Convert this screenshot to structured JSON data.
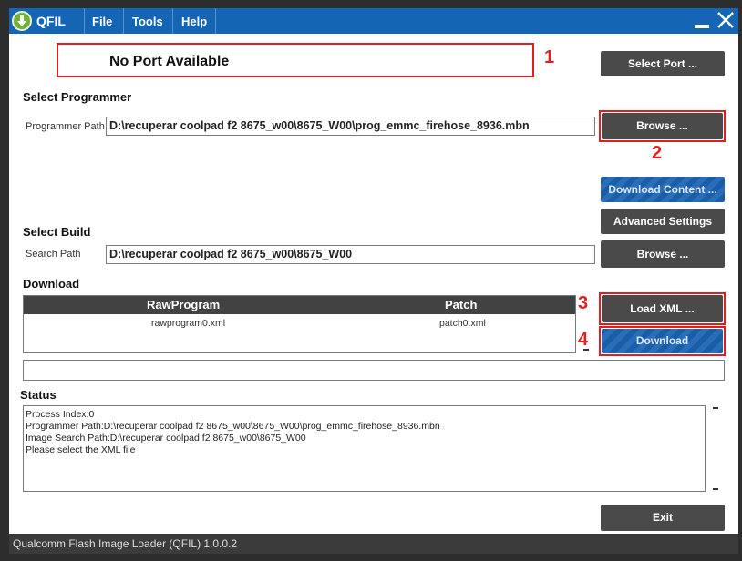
{
  "app": {
    "name": "QFIL"
  },
  "menu": {
    "file": "File",
    "tools": "Tools",
    "help": "Help"
  },
  "port": {
    "value": "No Port Available",
    "select_button": "Select Port ..."
  },
  "programmer": {
    "section_title": "Select Programmer",
    "path_label": "Programmer Path",
    "path_value": "D:\\recuperar coolpad f2 8675_w00\\8675_W00\\prog_emmc_firehose_8936.mbn",
    "browse_button": "Browse ..."
  },
  "buttons": {
    "download_content": "Download Content ...",
    "advanced_settings": "Advanced Settings",
    "load_xml": "Load XML ...",
    "download": "Download",
    "exit": "Exit"
  },
  "build": {
    "section_title": "Select Build",
    "search_label": "Search Path",
    "search_value": "D:\\recuperar coolpad f2 8675_w00\\8675_W00",
    "browse_button": "Browse ..."
  },
  "download": {
    "section_title": "Download",
    "columns": [
      "RawProgram",
      "Patch"
    ],
    "rows": [
      [
        "rawprogram0.xml",
        "patch0.xml"
      ]
    ],
    "progress_text": ""
  },
  "annotations": [
    "1",
    "2",
    "3",
    "4"
  ],
  "status": {
    "section_title": "Status",
    "lines": [
      "Process Index:0",
      "Programmer Path:D:\\recuperar coolpad f2 8675_w00\\8675_W00\\prog_emmc_firehose_8936.mbn",
      "Image Search Path:D:\\recuperar coolpad f2 8675_w00\\8675_W00",
      "Please select the XML file"
    ]
  },
  "statusbar": {
    "text": "Qualcomm Flash Image Loader (QFIL)   1.0.0.2"
  },
  "colors": {
    "titlebar": "#1565b5",
    "annotation_red": "#e02020",
    "button_dark": "#4a4a4a",
    "button_blue": "#1b5ea8"
  }
}
